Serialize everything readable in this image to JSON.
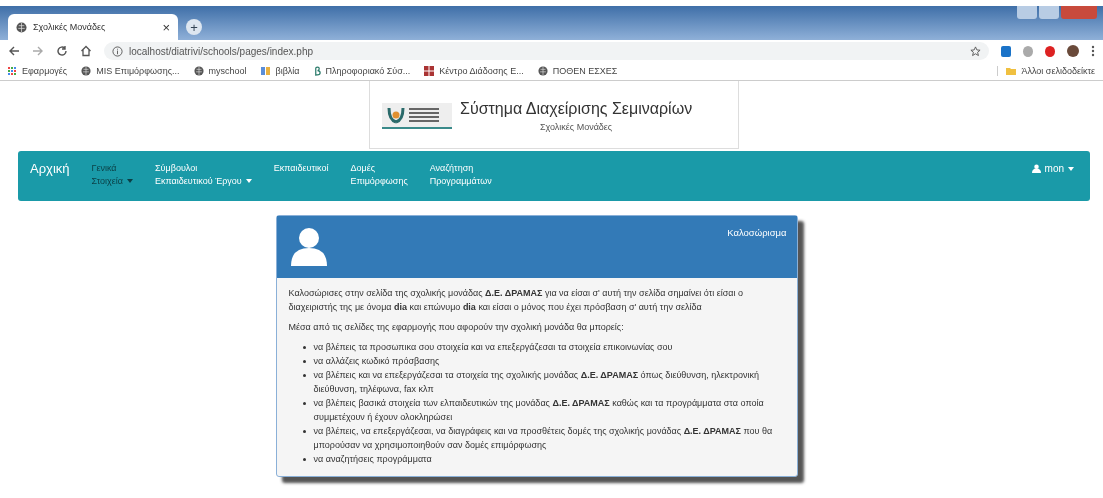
{
  "browser": {
    "tab": {
      "title": "Σχολικές Μονάδες",
      "close": "×",
      "new_tab": "+"
    },
    "address": "localhost/diatrivi/schools/pages/index.php",
    "bookmarks": [
      {
        "kind": "apps",
        "label": "Εφαρμογές"
      },
      {
        "kind": "globe",
        "label": "MIS Επιμόρφωσης..."
      },
      {
        "kind": "globe",
        "label": "myschool"
      },
      {
        "kind": "book",
        "label": "βιβλία"
      },
      {
        "kind": "beta",
        "label": "Πληροφοριακό Σύσ..."
      },
      {
        "kind": "tiles",
        "label": "Κέντρο Διάδοσης Ε..."
      },
      {
        "kind": "globe",
        "label": "ΠΟΘΕΝ ΕΣΧΕΣ"
      }
    ],
    "other_bookmarks": "Άλλοι σελιδοδείκτε"
  },
  "header": {
    "title": "Σύστημα Διαχείρισης Σεμιναρίων",
    "subtitle": "Σχολικές Μονάδες"
  },
  "navbar": {
    "brand": "Αρχική",
    "items": [
      {
        "lines": [
          "Γενικά",
          "Στοιχεία"
        ],
        "dropdown": true,
        "disabled": true
      },
      {
        "lines": [
          "Σύμβουλοι",
          "Εκπαιδευτικού Έργου"
        ],
        "dropdown": true,
        "disabled": false
      },
      {
        "lines": [
          "Εκπαιδευτικοί"
        ],
        "dropdown": false,
        "disabled": false
      },
      {
        "lines": [
          "Δομές",
          "Επιμόρφωσης"
        ],
        "dropdown": false,
        "disabled": false
      },
      {
        "lines": [
          "Αναζήτηση",
          "Προγραμμάτων"
        ],
        "dropdown": false,
        "disabled": false
      }
    ],
    "user": {
      "name": "mon",
      "dropdown": true
    }
  },
  "panel": {
    "heading": "Καλοσώρισμα",
    "intro": "Καλοσώρισες στην σελίδα της σχολικής μονάδας **Δ.Ε. ΔΡΑΜΑΣ** για να είσαι σ' αυτή την σελίδα σημαίνει ότι είσαι ο διαχειριστής της με όνομα **dia** και επώνυμο **dia** και είσαι ο μόνος που έχει πρόσβαση σ' αυτή την σελίδα",
    "lead": "Μέσα από τις σελίδες της εφαρμογής που αφορούν την σχολική μονάδα θα μπορείς:",
    "items": [
      "να βλέπεις τα προσωπικα σου στοιχεία και να επεξεργάζεσαι τα στοιχεία επικοινωνίας σου",
      "να αλλάζεις κωδικό πρόσβασης",
      "να βλέπεις και να επεξεργάζεσαι τα στοιχεία της σχολικής μονάδας **Δ.Ε. ΔΡΑΜΑΣ** όπως διεύθυνση, ηλεκτρονική διεύθυνση, τηλέφωνα, fax κλπ",
      "να βλέπεις βασικά στοιχεία των ελπαιδευτικών της μονάδας **Δ.Ε. ΔΡΑΜΑΣ** καθώς και τα προγράμματα στα οποία συμμετέχουν ή έχουν ολοκληρώσει",
      "να βλέπεις, να επεξεργάζεσαι, να διαγράφεις και να προσθέτεις δομές της σχολικής μονάδας **Δ.Ε. ΔΡΑΜΑΣ** που θα μπορούσαν να χρησιμοποιηθούν σαν δομές επιμόρφωσης",
      "να αναζητήσεις προγράμματα"
    ]
  }
}
